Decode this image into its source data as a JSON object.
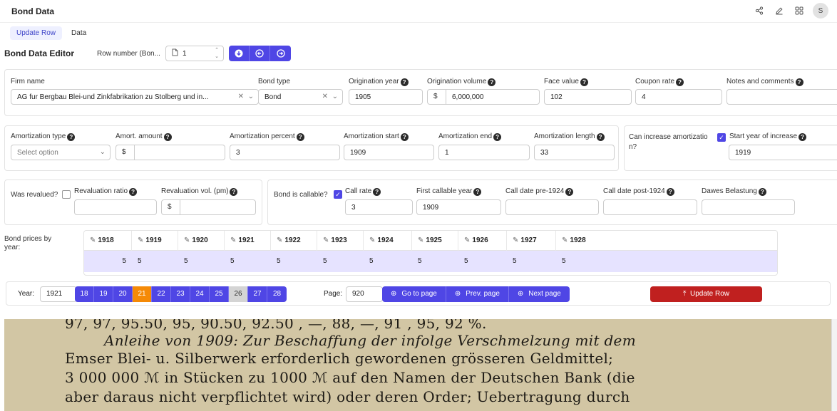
{
  "app": {
    "title": "Bond Data",
    "avatar_initial": "S"
  },
  "tabs": [
    "Update Row",
    "Data"
  ],
  "editor": {
    "title": "Bond Data Editor",
    "row_number_label": "Row number (Bon...",
    "row_number_value": "1"
  },
  "firm": {
    "firm_name_label": "Firm name",
    "firm_name_value": "AG fur Bergbau Blei-und Zinkfabrikation zu Stolberg und in...",
    "bond_type_label": "Bond type",
    "bond_type_value": "Bond",
    "origination_year_label": "Origination year",
    "origination_year_value": "1905",
    "origination_volume_label": "Origination volume",
    "origination_volume_value": "6,000,000",
    "face_value_label": "Face value",
    "face_value_value": "102",
    "coupon_rate_label": "Coupon rate",
    "coupon_rate_value": "4",
    "notes_label": "Notes and comments",
    "notes_value": ""
  },
  "amortization": {
    "type_label": "Amortization type",
    "type_placeholder": "Select option",
    "amount_label": "Amort. amount",
    "amount_value": "",
    "percent_label": "Amortization percent",
    "percent_value": "3",
    "start_label": "Amortization start",
    "start_value": "1909",
    "end_label": "Amortization end",
    "end_value": "1",
    "length_label": "Amortization length",
    "length_value": "33",
    "can_increase_label_1": "Can increase amortizatio",
    "can_increase_label_2": "n?",
    "start_year_increase_label": "Start year of increase",
    "start_year_increase_value": "1919"
  },
  "revaluation": {
    "was_revalued_label": "Was revalued?",
    "ratio_label": "Revaluation ratio",
    "ratio_value": "",
    "vol_label": "Revaluation vol. (pm)",
    "vol_value": ""
  },
  "callable": {
    "is_callable_label": "Bond is callable?",
    "call_rate_label": "Call rate",
    "call_rate_value": "3",
    "first_callable_label": "First callable year",
    "first_callable_value": "1909",
    "pre_1924_label": "Call date pre-1924",
    "pre_1924_value": "",
    "post_1924_label": "Call date post-1924",
    "post_1924_value": "",
    "dawes_label": "Dawes Belastung",
    "dawes_value": ""
  },
  "prices": {
    "label_1": "Bond prices by",
    "label_2": "year:",
    "years": [
      "1918",
      "1919",
      "1920",
      "1921",
      "1922",
      "1923",
      "1924",
      "1925",
      "1926",
      "1927",
      "1928"
    ],
    "row_index": "5",
    "values": [
      "5",
      "5",
      "5",
      "5",
      "5",
      "5",
      "5",
      "5",
      "5",
      "5"
    ]
  },
  "pager": {
    "year_label": "Year:",
    "year_value": "1921",
    "year_buttons": [
      "18",
      "19",
      "20",
      "21",
      "22",
      "23",
      "24",
      "25",
      "26",
      "27",
      "28"
    ],
    "page_label": "Page:",
    "page_value": "920",
    "go_to_page": "Go to page",
    "prev_page": "Prev. page",
    "next_page": "Next page",
    "update_row": "Update Row"
  },
  "scan_text": [
    "97, 97, 95.50, 95, 90.50, 92.50 , —, 88, —, 91 , 95, 92 %.",
    "Anleihe von 1909: Zur Beschaffung der infolge Verschmelzung mit dem",
    "Emser Blei- u. Silberwerk erforderlich gewordenen grösseren Geldmittel;",
    "3 000 000 ℳ in Stücken zu 1000 ℳ auf den Namen der Deutschen Bank (die",
    "aber daraus nicht verpflichtet wird) oder deren Order; Uebertragung durch"
  ],
  "colors": {
    "primary": "#4f46e5",
    "current_year": "#f58a07",
    "update": "#c0201f"
  }
}
